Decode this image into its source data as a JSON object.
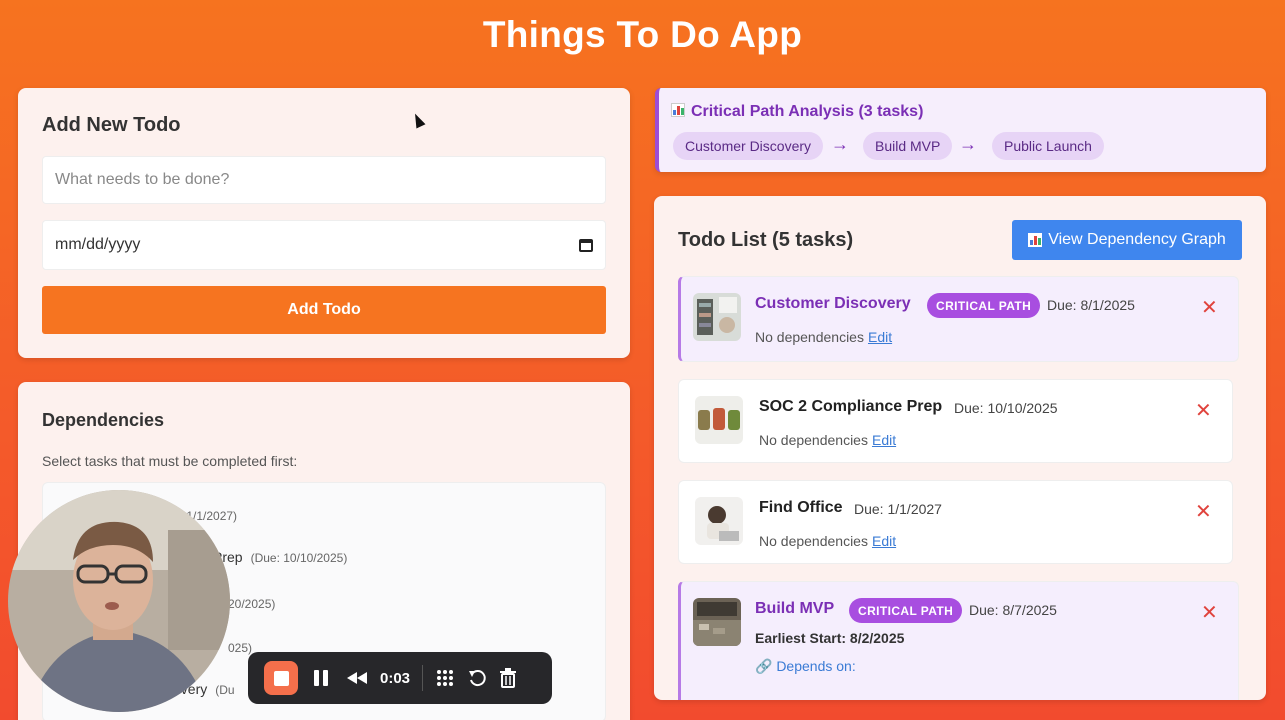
{
  "app": {
    "title": "Things To Do App"
  },
  "add_form": {
    "heading": "Add New Todo",
    "title_placeholder": "What needs to be done?",
    "date_placeholder": "mm/dd/yyyy",
    "submit_label": "Add Todo"
  },
  "dependencies": {
    "heading": "Dependencies",
    "hint": "Select tasks that must be completed first:",
    "options": [
      {
        "label": "",
        "due": "e: 1/1/2027)"
      },
      {
        "label": "Prep",
        "due": "(Due: 10/10/2025)"
      },
      {
        "label": "",
        "due": "20/2025)"
      },
      {
        "label": "",
        "due": "025)"
      },
      {
        "label": "overy",
        "due": "(Du"
      }
    ]
  },
  "critical_path": {
    "title": "Critical Path Analysis (3 tasks)",
    "chips": [
      "Customer Discovery",
      "Build MVP",
      "Public Launch"
    ],
    "arrow": "→",
    "accent": "#7b2fb5"
  },
  "todo_list": {
    "title": "Todo List (5 tasks)",
    "graph_button": "View Dependency Graph",
    "badge_label": "CRITICAL PATH",
    "delete_glyph": "✕",
    "edit_label": "Edit",
    "items": [
      {
        "name": "Customer Discovery",
        "critical": true,
        "due": "Due: 8/1/2025",
        "deps": "No dependencies"
      },
      {
        "name": "SOC 2 Compliance Prep",
        "critical": false,
        "due": "Due: 10/10/2025",
        "deps": "No dependencies"
      },
      {
        "name": "Find Office",
        "critical": false,
        "due": "Due: 1/1/2027",
        "deps": "No dependencies"
      },
      {
        "name": "Build MVP",
        "critical": true,
        "due": "Due: 8/7/2025",
        "earliest": "Earliest Start: 8/2/2025",
        "depends_on": "🔗 Depends on:"
      }
    ]
  },
  "recorder": {
    "time": "0:03"
  },
  "colors": {
    "background": "#f6731f",
    "primary_button": "#f67420",
    "info_button": "#3f86ee",
    "badge": "#a84ee0",
    "delete": "#e0433d"
  }
}
